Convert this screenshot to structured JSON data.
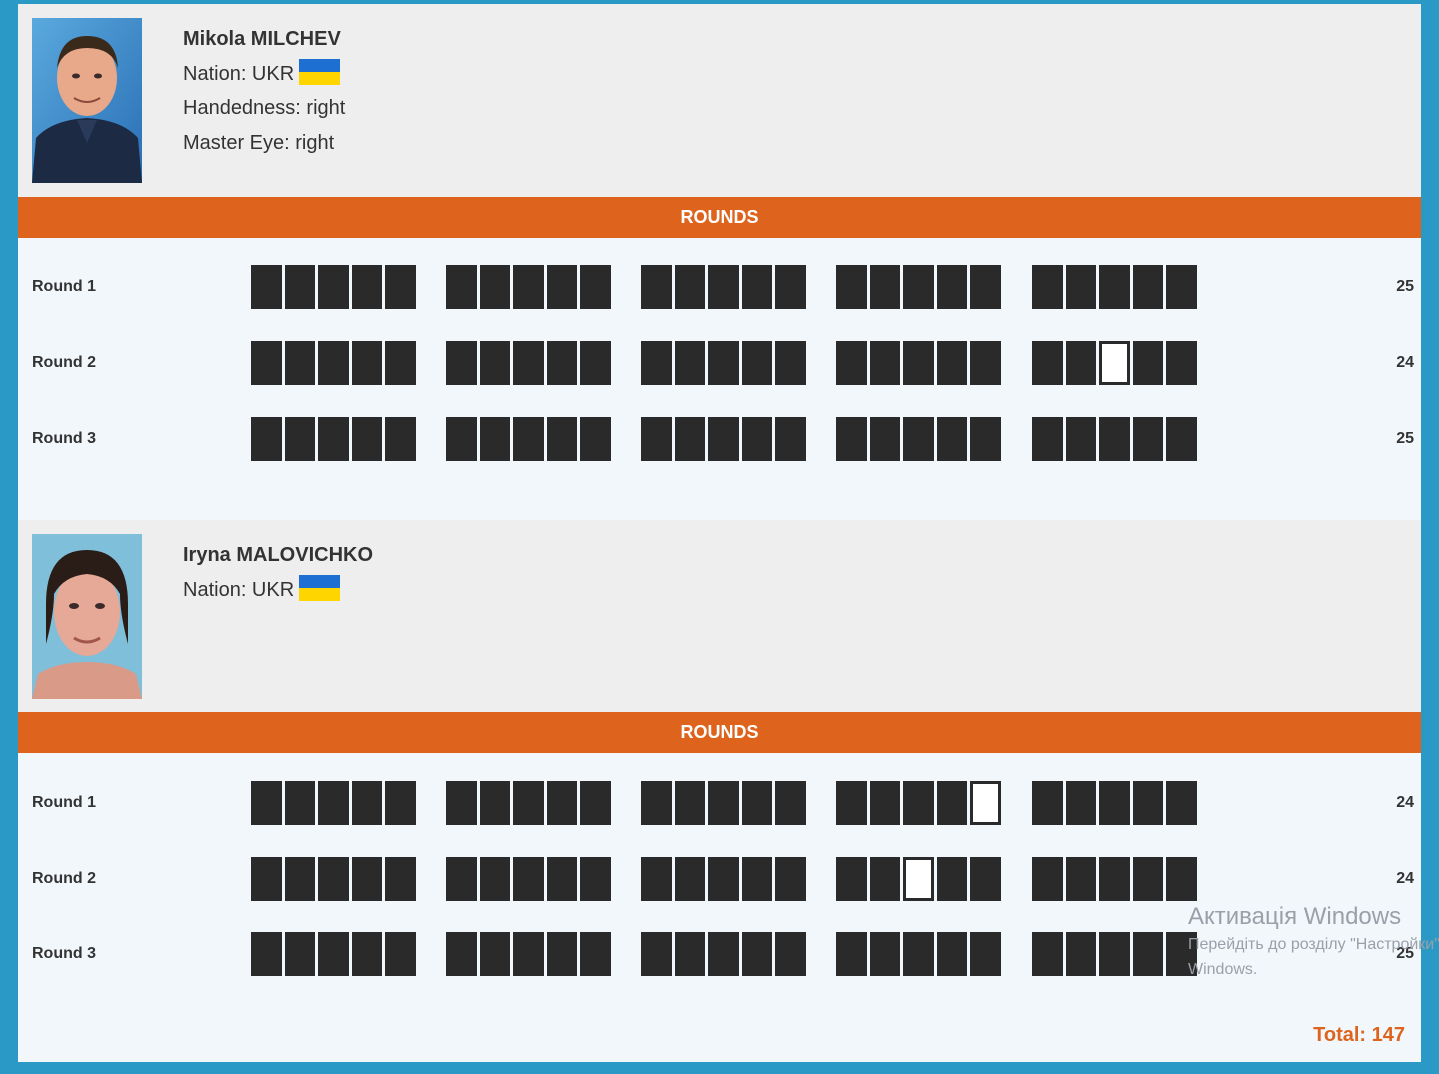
{
  "rounds_header": "ROUNDS",
  "athletes": [
    {
      "name": "Mikola MILCHEV",
      "nation_label": "Nation: UKR",
      "handedness": "Handedness: right",
      "master_eye": "Master Eye: right",
      "rounds": [
        {
          "label": "Round 1",
          "score": "25",
          "misses": []
        },
        {
          "label": "Round 2",
          "score": "24",
          "misses": [
            [
              4,
              2
            ]
          ]
        },
        {
          "label": "Round 3",
          "score": "25",
          "misses": []
        }
      ]
    },
    {
      "name": "Iryna MALOVICHKO",
      "nation_label": "Nation: UKR",
      "rounds": [
        {
          "label": "Round 1",
          "score": "24",
          "misses": [
            [
              3,
              4
            ]
          ]
        },
        {
          "label": "Round 2",
          "score": "24",
          "misses": [
            [
              3,
              2
            ]
          ]
        },
        {
          "label": "Round 3",
          "score": "25",
          "misses": []
        }
      ]
    }
  ],
  "total": "Total: 147",
  "watermark": {
    "title": "Активація Windows",
    "line1": "Перейдіть до розділу \"Настройки\"",
    "line2": "Windows."
  },
  "colors": {
    "frame": "#2b99c5",
    "accent": "#de631d",
    "hit": "#2a2a2a",
    "miss": "#ffffff",
    "flag_blue": "#1d6fd1",
    "flag_yellow": "#ffd500"
  },
  "icons": [
    "athlete-photo",
    "ukraine-flag-icon"
  ]
}
